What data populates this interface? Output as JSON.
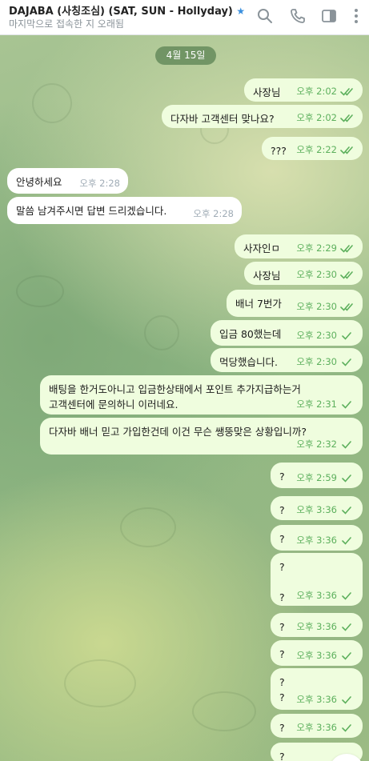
{
  "header": {
    "title": "DAJABA (사칭조심) (SAT, SUN - Hollyday)",
    "star_icon": "star-icon",
    "status": "마지막으로 접속한 지 오래됨"
  },
  "date_label": "4월 15일",
  "colors": {
    "outgoing": "#effdde",
    "incoming": "#ffffff",
    "check": "#5db05d"
  },
  "messages": [
    {
      "dir": "out",
      "text": "사장님",
      "time": "오후 2:02",
      "read": true
    },
    {
      "dir": "out",
      "text": "다자바 고객센터 맞나요?",
      "time": "오후 2:02",
      "read": true
    },
    {
      "dir": "out",
      "text": "???",
      "time": "오후 2:22",
      "read": true
    },
    {
      "dir": "in",
      "text": "안녕하세요",
      "time": "오후 2:28"
    },
    {
      "dir": "in",
      "text": "말씀 남겨주시면 답변 드리겠습니다.",
      "time": "오후 2:28"
    },
    {
      "dir": "out",
      "text": "사자인ㅁ",
      "time": "오후 2:29",
      "read": true
    },
    {
      "dir": "out",
      "text": "사장님",
      "time": "오후 2:30",
      "read": true
    },
    {
      "dir": "out",
      "text": "배너 7번가",
      "time": "오후 2:30",
      "read": true
    },
    {
      "dir": "out",
      "text": "입금 80했는데",
      "time": "오후 2:30",
      "read": false
    },
    {
      "dir": "out",
      "text": "먹당했습니다.",
      "time": "오후 2:30",
      "read": false
    },
    {
      "dir": "out",
      "text": "배팅을 한거도아니고 입금한상태에서 포인트 추가지급하는거\n고객센터에 문의하니 이러네요.",
      "time": "오후 2:31",
      "read": false
    },
    {
      "dir": "out",
      "text": "다자바 배너 믿고 가입한건데 이건 무슨 쌩뚱맞은 상황입니까?",
      "time": "오후 2:32",
      "read": false
    },
    {
      "dir": "out",
      "text": "?",
      "time": "오후 2:59",
      "read": false
    },
    {
      "dir": "out",
      "text": "?",
      "time": "오후 3:36",
      "read": false
    },
    {
      "dir": "out",
      "text": "?",
      "time": "오후 3:36",
      "read": false
    },
    {
      "dir": "out",
      "text": "?\n\n?",
      "time": "오후 3:36",
      "read": false
    },
    {
      "dir": "out",
      "text": "?",
      "time": "오후 3:36",
      "read": false
    },
    {
      "dir": "out",
      "text": "?",
      "time": "오후 3:36",
      "read": false
    },
    {
      "dir": "out",
      "text": "?\n?",
      "time": "오후 3:36",
      "read": false
    },
    {
      "dir": "out",
      "text": "?",
      "time": "오후 3:36",
      "read": false
    },
    {
      "dir": "out",
      "text": "?",
      "time": "",
      "read": false
    }
  ]
}
